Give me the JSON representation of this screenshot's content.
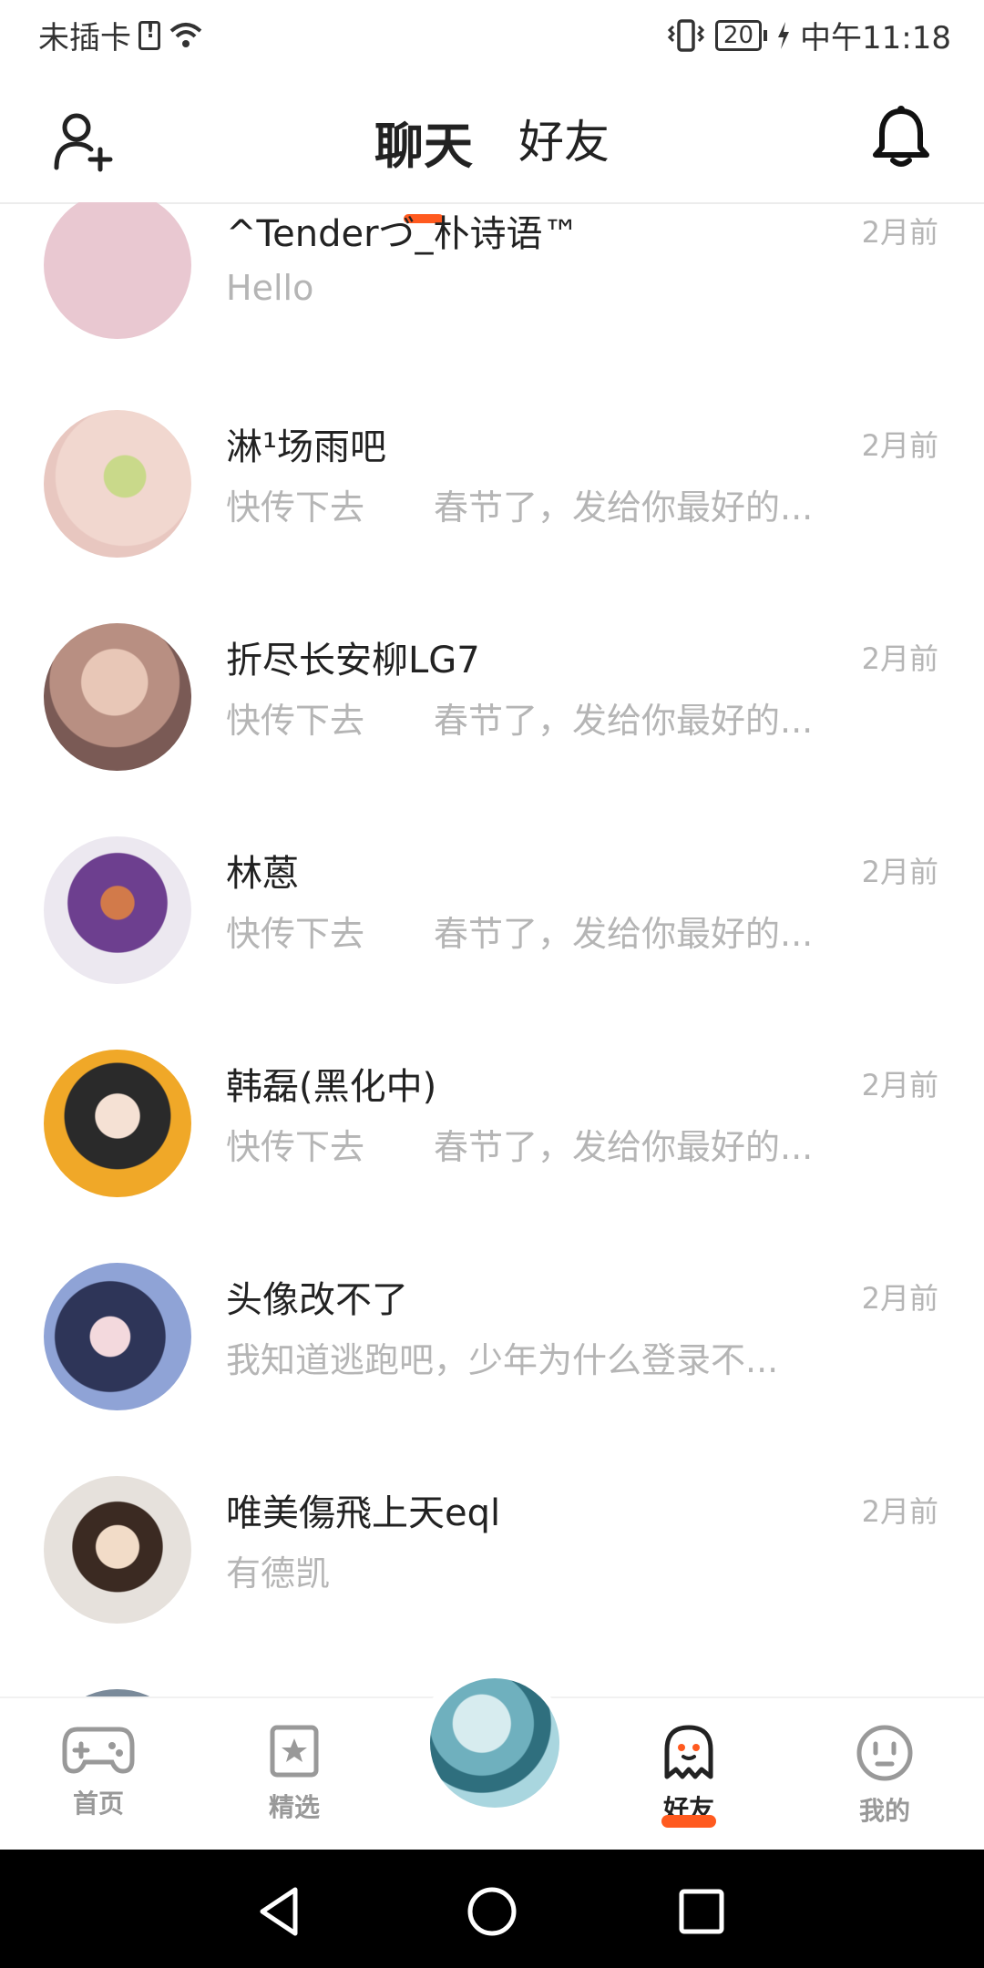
{
  "status_bar": {
    "carrier": "未插卡",
    "battery": "20",
    "time": "中午11:18"
  },
  "header": {
    "tabs": [
      {
        "label": "聊天",
        "active": true
      },
      {
        "label": "好友",
        "active": false
      }
    ]
  },
  "colors": {
    "accent": "#ff5a1f",
    "muted_text": "#b5b5b5"
  },
  "chats": [
    {
      "name": "^Tenderづ_朴诗语™",
      "message": "Hello",
      "time": "2月前",
      "avatar_color": "#e9c8d1"
    },
    {
      "name": "淋¹场雨吧",
      "message": "快传下去　　春节了，发给你最好的...",
      "time": "2月前",
      "avatar_color": "#f0d6cf"
    },
    {
      "name": "折尽长安柳LG7",
      "message": "快传下去　　春节了，发给你最好的...",
      "time": "2月前",
      "avatar_color": "#c9a99d"
    },
    {
      "name": "林蒽",
      "message": "快传下去　　春节了，发给你最好的...",
      "time": "2月前",
      "avatar_color": "#e7e3ef"
    },
    {
      "name": "韩磊(黑化中)",
      "message": "快传下去　　春节了，发给你最好的...",
      "time": "2月前",
      "avatar_color": "#f0a828"
    },
    {
      "name": "头像改不了",
      "message": "我知道逃跑吧，少年为什么登录不...",
      "time": "2月前",
      "avatar_color": "#6f7fb3"
    },
    {
      "name": "唯美傷飛上天eql",
      "message": "有德凯",
      "time": "2月前",
      "avatar_color": "#e9e5e0"
    }
  ],
  "bottom_nav": [
    {
      "label": "首页",
      "icon": "gamepad-icon"
    },
    {
      "label": "精选",
      "icon": "star-card-icon"
    },
    {
      "label": "好友",
      "icon": "ghost-icon"
    },
    {
      "label": "我的",
      "icon": "face-icon"
    }
  ]
}
